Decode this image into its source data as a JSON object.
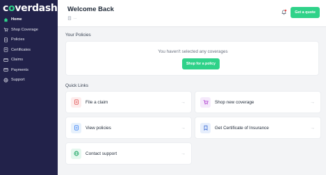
{
  "brand": {
    "pre": "c",
    "accent_o": "o",
    "post": "verdash",
    "accent_color": "#2fd289"
  },
  "sidebar": {
    "items": [
      {
        "label": "Home",
        "icon": "home-icon",
        "active": true
      },
      {
        "label": "Shop Coverage",
        "icon": "cart-icon"
      },
      {
        "label": "Policies",
        "icon": "document-icon"
      },
      {
        "label": "Certificates",
        "icon": "certificate-icon"
      },
      {
        "label": "Claims",
        "icon": "claims-icon"
      },
      {
        "label": "Payments",
        "icon": "card-icon"
      },
      {
        "label": "Support",
        "icon": "globe-icon"
      }
    ]
  },
  "header": {
    "title": "Welcome Back",
    "subtitle": "...",
    "quote_button": "Get a quote"
  },
  "policies": {
    "section_title": "Your Policies",
    "empty_text": "You haven't selected any coverages",
    "shop_button": "Shop for a policy"
  },
  "quick_links": {
    "section_title": "Quick Links",
    "items": [
      {
        "label": "File a claim",
        "icon": "claim-file-icon",
        "arrow": "→"
      },
      {
        "label": "Shop new coverage",
        "icon": "cart-icon",
        "arrow": "→"
      },
      {
        "label": "View policies",
        "icon": "document-icon",
        "arrow": "→"
      },
      {
        "label": "Get Certificate of Insurance",
        "icon": "certificate-icon",
        "arrow": "→"
      },
      {
        "label": "Contact support",
        "icon": "globe-icon",
        "arrow": "→"
      }
    ]
  }
}
